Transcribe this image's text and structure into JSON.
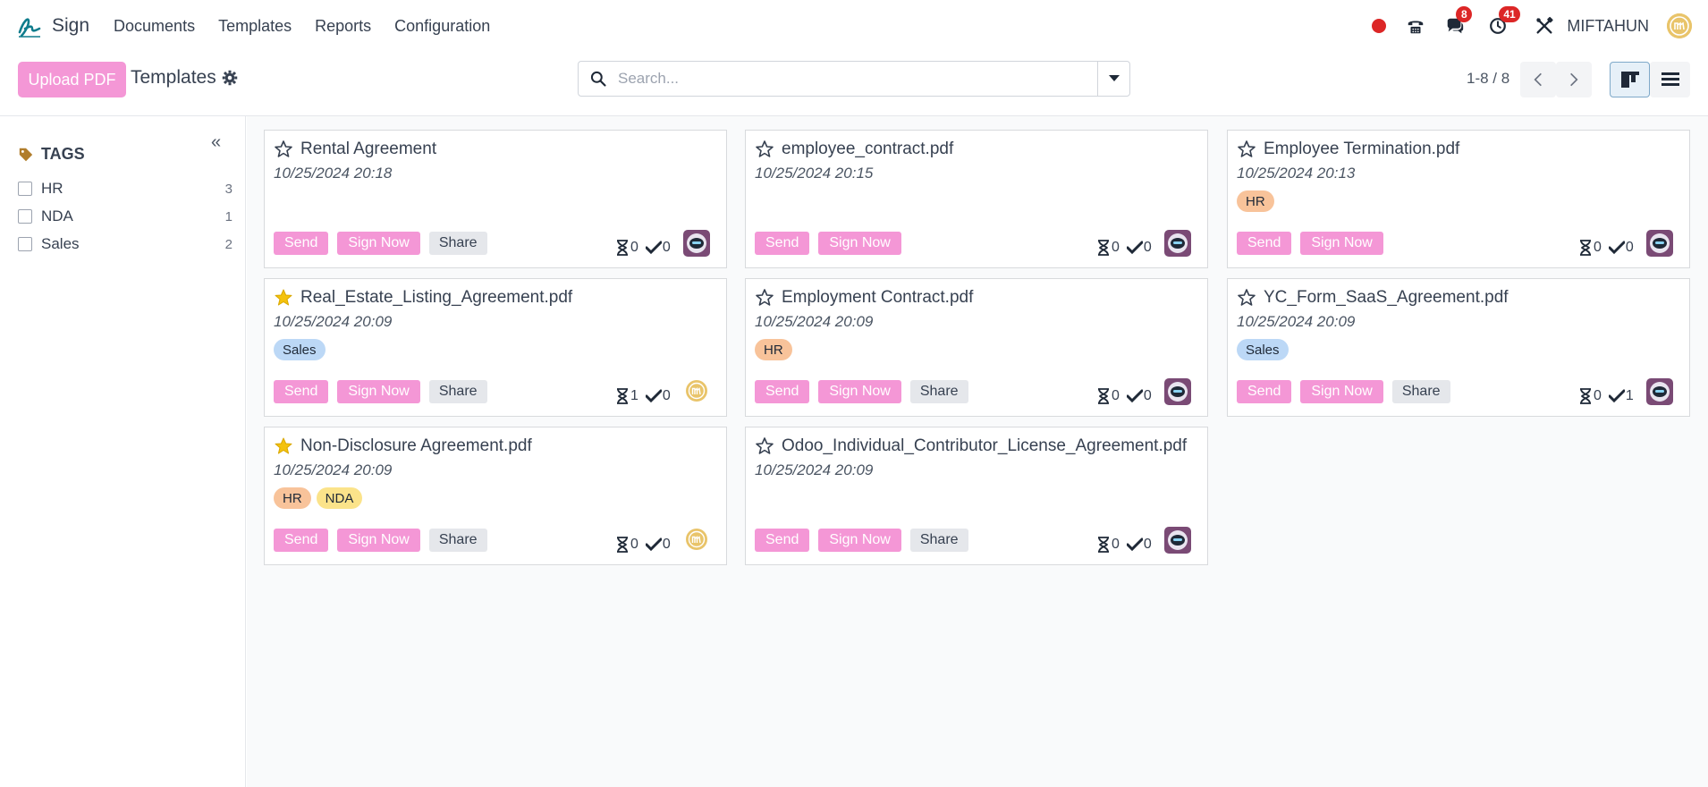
{
  "app": {
    "name": "Sign"
  },
  "menu": [
    {
      "label": "Documents"
    },
    {
      "label": "Templates"
    },
    {
      "label": "Reports"
    },
    {
      "label": "Configuration"
    }
  ],
  "systray": {
    "messages_count": "8",
    "activities_count": "41",
    "user_name": "MIFTAHUN"
  },
  "control": {
    "upload_label": "Upload PDF",
    "page_title": "Templates",
    "search_placeholder": "Search...",
    "pager": "1-8 / 8"
  },
  "sidebar": {
    "heading": "TAGS",
    "tags": [
      {
        "label": "HR",
        "count": "3"
      },
      {
        "label": "NDA",
        "count": "1"
      },
      {
        "label": "Sales",
        "count": "2"
      }
    ]
  },
  "labels": {
    "send": "Send",
    "sign_now": "Sign Now",
    "share": "Share"
  },
  "colors": {
    "accent": "#f497d6",
    "tag_HR": "#f8c39a",
    "tag_NDA": "#fbe38a",
    "tag_Sales": "#bcd8f6",
    "star_filled": "#f4c20d"
  },
  "cards": [
    {
      "title": "Rental Agreement",
      "date": "10/25/2024 20:18",
      "starred": false,
      "tags": [],
      "share": true,
      "pending": "0",
      "signed": "0",
      "avatar": "robot"
    },
    {
      "title": "employee_contract.pdf",
      "date": "10/25/2024 20:15",
      "starred": false,
      "tags": [],
      "share": false,
      "pending": "0",
      "signed": "0",
      "avatar": "robot"
    },
    {
      "title": "Employee Termination.pdf",
      "date": "10/25/2024 20:13",
      "starred": false,
      "tags": [
        "HR"
      ],
      "share": false,
      "pending": "0",
      "signed": "0",
      "avatar": "robot"
    },
    {
      "title": "Real_Estate_Listing_Agreement.pdf",
      "date": "10/25/2024 20:09",
      "starred": true,
      "tags": [
        "Sales"
      ],
      "share": true,
      "pending": "1",
      "signed": "0",
      "avatar": "user"
    },
    {
      "title": "Employment Contract.pdf",
      "date": "10/25/2024 20:09",
      "starred": false,
      "tags": [
        "HR"
      ],
      "share": true,
      "pending": "0",
      "signed": "0",
      "avatar": "robot"
    },
    {
      "title": "YC_Form_SaaS_Agreement.pdf",
      "date": "10/25/2024 20:09",
      "starred": false,
      "tags": [
        "Sales"
      ],
      "share": true,
      "pending": "0",
      "signed": "1",
      "avatar": "robot"
    },
    {
      "title": "Non-Disclosure Agreement.pdf",
      "date": "10/25/2024 20:09",
      "starred": true,
      "tags": [
        "HR",
        "NDA"
      ],
      "share": true,
      "pending": "0",
      "signed": "0",
      "avatar": "user"
    },
    {
      "title": "Odoo_Individual_Contributor_License_Agreement.pdf",
      "date": "10/25/2024 20:09",
      "starred": false,
      "tags": [],
      "share": true,
      "pending": "0",
      "signed": "0",
      "avatar": "robot"
    }
  ]
}
